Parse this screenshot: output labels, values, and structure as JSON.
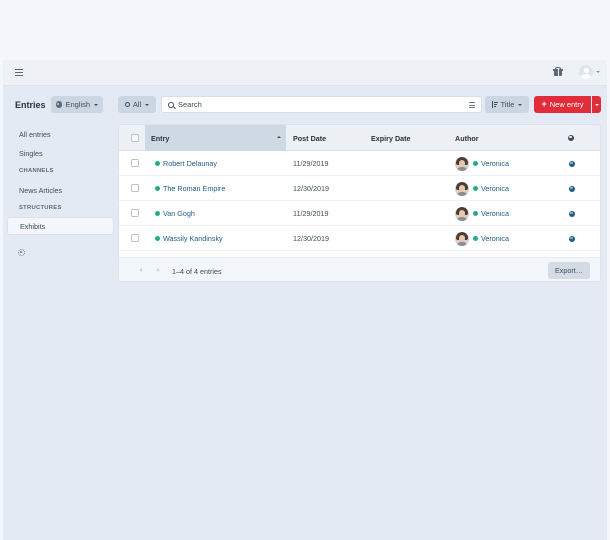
{
  "header": {
    "menu_icon": "hamburger-icon",
    "gift_icon": "gift-icon",
    "avatar_icon": "user-avatar-icon"
  },
  "toolbar": {
    "title": "Entries",
    "site_label": "English",
    "status_label": "All",
    "search_placeholder": "Search",
    "sort_label": "Title",
    "new_entry_label": "New entry",
    "new_entry_color": "#e12d39"
  },
  "sidebar": {
    "items": [
      {
        "label": "All entries"
      },
      {
        "label": "Singles"
      },
      {
        "label": "News Articles"
      },
      {
        "label": "Exhibits",
        "active": true
      }
    ],
    "headings": [
      "CHANNELS",
      "STRUCTURES"
    ]
  },
  "table": {
    "columns": [
      "Entry",
      "Post Date",
      "Expiry Date",
      "Author"
    ],
    "sorted_column": "Entry",
    "rows": [
      {
        "title": "Robert Delaunay",
        "post_date": "11/29/2019",
        "expiry_date": "",
        "author": "Veronica",
        "status_color": "#27ab83"
      },
      {
        "title": "The Roman Empire",
        "post_date": "12/30/2019",
        "expiry_date": "",
        "author": "Veronica",
        "status_color": "#27ab83"
      },
      {
        "title": "Van Gogh",
        "post_date": "11/29/2019",
        "expiry_date": "",
        "author": "Veronica",
        "status_color": "#27ab83"
      },
      {
        "title": "Wassily Kandinsky",
        "post_date": "12/30/2019",
        "expiry_date": "",
        "author": "Veronica",
        "status_color": "#27ab83"
      }
    ],
    "footer": {
      "count_text": "1–4 of 4 entries",
      "export_label": "Export…"
    }
  }
}
